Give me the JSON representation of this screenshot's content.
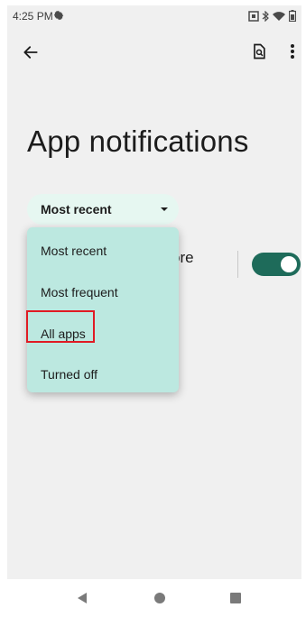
{
  "status_bar": {
    "time": "4:25 PM",
    "icons": [
      "gear-icon",
      "cast-icon",
      "bluetooth-icon",
      "wifi-icon",
      "battery-icon"
    ]
  },
  "app_bar": {
    "back_icon": "arrow-back-icon",
    "search_icon": "search-doc-icon",
    "overflow_icon": "more-vert-icon"
  },
  "page": {
    "title": "App notifications"
  },
  "filter": {
    "selected": "Most recent",
    "options": [
      "Most recent",
      "Most frequent",
      "All apps",
      "Turned off"
    ],
    "highlighted": "All apps"
  },
  "background_row": {
    "visible_text": "ore",
    "toggle_on": true
  },
  "colors": {
    "accent": "#1e6b5a",
    "chip_bg": "#e6f7f1",
    "menu_bg": "#bce8e0",
    "highlight": "#e01b24"
  },
  "nav_bar": {
    "icons": [
      "nav-back-icon",
      "nav-home-icon",
      "nav-recents-icon"
    ]
  }
}
